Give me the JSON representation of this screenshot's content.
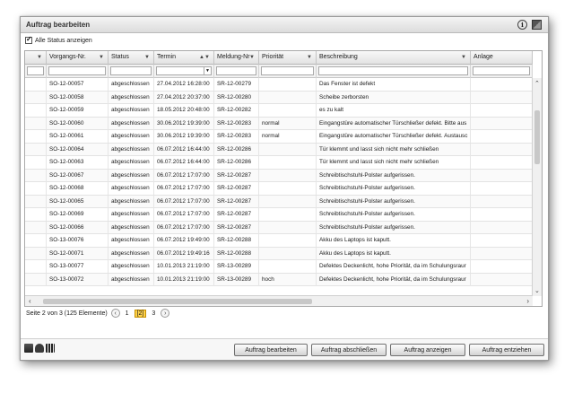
{
  "window": {
    "title": "Auftrag bearbeiten"
  },
  "titlebar": {
    "info_icon": "info-icon",
    "resize_icon": "resize-icon"
  },
  "filter": {
    "all_status_label": "Alle Status anzeigen",
    "checked": true
  },
  "columns": [
    "",
    "Vorgangs-Nr.",
    "Status",
    "Termin",
    "Meldung-Nr",
    "Priorität",
    "Beschreibung",
    "Anlage"
  ],
  "rows": [
    [
      "",
      "SO-12-00057",
      "abgeschlossen",
      "27.04.2012 16:28:00",
      "SR-12-00279",
      "",
      "Das Fenster ist defekt",
      ""
    ],
    [
      "",
      "SO-12-00058",
      "abgeschlossen",
      "27.04.2012 20:37:00",
      "SR-12-00280",
      "",
      "Scheibe zerborsten",
      ""
    ],
    [
      "",
      "SO-12-00059",
      "abgeschlossen",
      "18.05.2012 20:48:00",
      "SR-12-00282",
      "",
      "es zu kalt",
      ""
    ],
    [
      "",
      "SO-12-00060",
      "abgeschlossen",
      "30.06.2012 19:39:00",
      "SR-12-00283",
      "normal",
      "Eingangstüre automatischer Türschließer defekt. Bitte aus",
      ""
    ],
    [
      "",
      "SO-12-00061",
      "abgeschlossen",
      "30.06.2012 19:39:00",
      "SR-12-00283",
      "normal",
      "Eingangstüre automatischer Türschließer defekt. Austausc",
      ""
    ],
    [
      "",
      "SO-12-00064",
      "abgeschlossen",
      "06.07.2012 16:44:00",
      "SR-12-00286",
      "",
      "Tür klemmt und lasst sich nicht mehr schließen",
      ""
    ],
    [
      "",
      "SO-12-00063",
      "abgeschlossen",
      "06.07.2012 16:44:00",
      "SR-12-00286",
      "",
      "Tür klemmt und lasst sich nicht mehr schließen",
      ""
    ],
    [
      "",
      "SO-12-00067",
      "abgeschlossen",
      "06.07.2012 17:07:00",
      "SR-12-00287",
      "",
      "Schreibtischstuhl-Polster aufgerissen.",
      ""
    ],
    [
      "",
      "SO-12-00068",
      "abgeschlossen",
      "06.07.2012 17:07:00",
      "SR-12-00287",
      "",
      "Schreibtischstuhl-Polster aufgerissen.",
      ""
    ],
    [
      "",
      "SO-12-00065",
      "abgeschlossen",
      "06.07.2012 17:07:00",
      "SR-12-00287",
      "",
      "Schreibtischstuhl-Polster aufgerissen.",
      ""
    ],
    [
      "",
      "SO-12-00069",
      "abgeschlossen",
      "06.07.2012 17:07:00",
      "SR-12-00287",
      "",
      "Schreibtischstuhl-Polster aufgerissen.",
      ""
    ],
    [
      "",
      "SO-12-00066",
      "abgeschlossen",
      "06.07.2012 17:07:00",
      "SR-12-00287",
      "",
      "Schreibtischstuhl-Polster aufgerissen.",
      ""
    ],
    [
      "",
      "SO-13-00076",
      "abgeschlossen",
      "06.07.2012 19:49:00",
      "SR-12-00288",
      "",
      "Akku des Laptops ist kaputt.",
      ""
    ],
    [
      "",
      "SO-12-00071",
      "abgeschlossen",
      "06.07.2012 19:49:16",
      "SR-12-00288",
      "",
      "Akku des Laptops ist kaputt.",
      ""
    ],
    [
      "",
      "SO-13-00077",
      "abgeschlossen",
      "10.01.2013 21:19:00",
      "SR-13-00289",
      "",
      "Defektes Deckenlicht, hohe Priorität, da im Schulungsraur",
      ""
    ],
    [
      "",
      "SO-13-00072",
      "abgeschlossen",
      "10.01.2013 21:19:00",
      "SR-13-00289",
      "hoch",
      "Defektes Deckenlicht, hohe Priorität, da im Schulungsraur",
      ""
    ]
  ],
  "pager": {
    "summary": "Seite 2 von 3 (125 Elemente)",
    "pages": [
      "1",
      "[2]",
      "3"
    ]
  },
  "buttons": {
    "edit": "Auftrag bearbeiten",
    "close": "Auftrag abschließen",
    "show": "Auftrag anzeigen",
    "withdraw": "Auftrag entziehen"
  },
  "bottom_icons": [
    "export-icon",
    "print-icon",
    "columns-icon"
  ]
}
